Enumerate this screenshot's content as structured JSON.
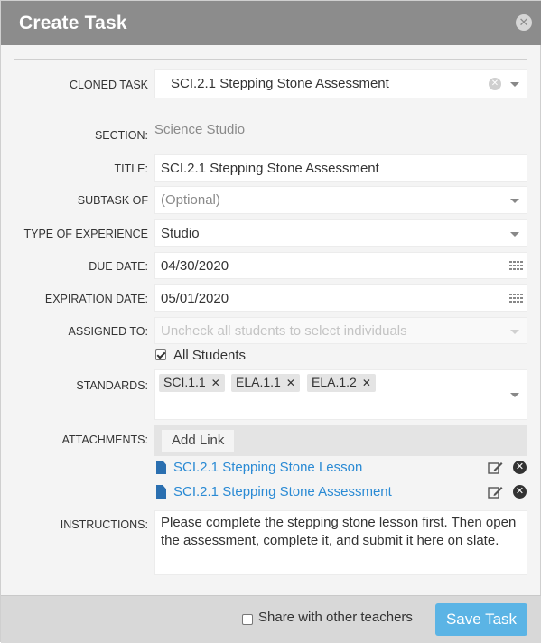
{
  "dialog": {
    "title": "Create Task",
    "close_icon": "close-icon"
  },
  "form": {
    "cloned_task": {
      "label": "CLONED TASK",
      "value": "SCI.2.1 Stepping Stone Assessment"
    },
    "section": {
      "label": "SECTION:",
      "value": "Science Studio"
    },
    "title": {
      "label": "TITLE:",
      "value": "SCI.2.1 Stepping Stone Assessment"
    },
    "subtask_of": {
      "label": "SUBTASK OF",
      "placeholder": "(Optional)"
    },
    "type_of_experience": {
      "label": "TYPE OF EXPERIENCE",
      "value": "Studio"
    },
    "due_date": {
      "label": "DUE DATE:",
      "value": "04/30/2020"
    },
    "expiration_date": {
      "label": "EXPIRATION DATE:",
      "value": "05/01/2020"
    },
    "assigned_to": {
      "label": "ASSIGNED TO:",
      "placeholder": "Uncheck all students to select individuals"
    },
    "all_students": {
      "label": "All Students",
      "checked": true
    },
    "standards": {
      "label": "STANDARDS:",
      "chips": [
        "SCI.1.1",
        "ELA.1.1",
        "ELA.1.2"
      ]
    },
    "attachments": {
      "label": "ATTACHMENTS:",
      "add_link_label": "Add Link",
      "files": [
        "SCI.2.1 Stepping Stone Lesson",
        "SCI.2.1 Stepping Stone Assessment"
      ]
    },
    "instructions": {
      "label": "INSTRUCTIONS:",
      "value": "Please complete the stepping stone lesson first. Then open the assessment, complete it, and submit it here on slate."
    }
  },
  "footer": {
    "share_label": "Share with other teachers",
    "share_checked": false,
    "save_label": "Save Task"
  },
  "colors": {
    "header_bg": "#8c8c8c",
    "link": "#2a8ad4",
    "save_button": "#5bb4e5",
    "doc_icon": "#2a6fb0"
  }
}
